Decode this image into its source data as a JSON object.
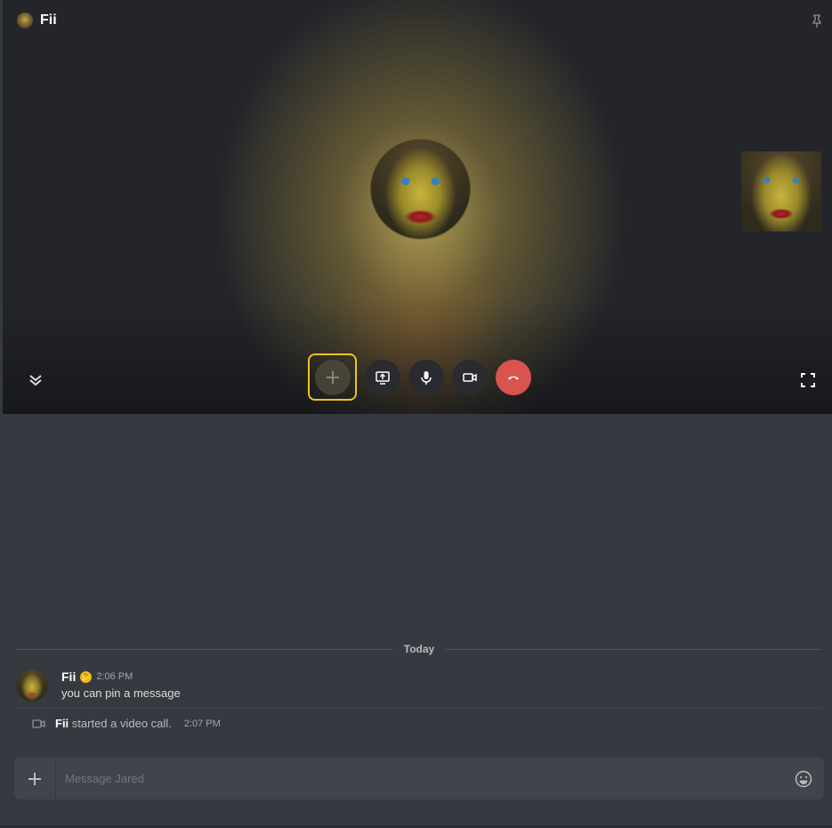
{
  "call": {
    "title": "Fii",
    "buttons": {
      "add": "add-participant",
      "screen_share": "screen-share",
      "mic": "microphone",
      "camera": "camera",
      "end": "end-call"
    }
  },
  "chat": {
    "divider_label": "Today",
    "message": {
      "author": "Fii",
      "emoji": "🤔",
      "time": "2:06 PM",
      "text": "you can pin a message"
    },
    "system": {
      "author": "Fii",
      "text": "started a video call.",
      "time": "2:07 PM"
    },
    "composer": {
      "placeholder": "Message Jared"
    }
  },
  "colors": {
    "highlight": "#f0c31c",
    "end_call": "#d9534f",
    "background": "#36393f"
  }
}
